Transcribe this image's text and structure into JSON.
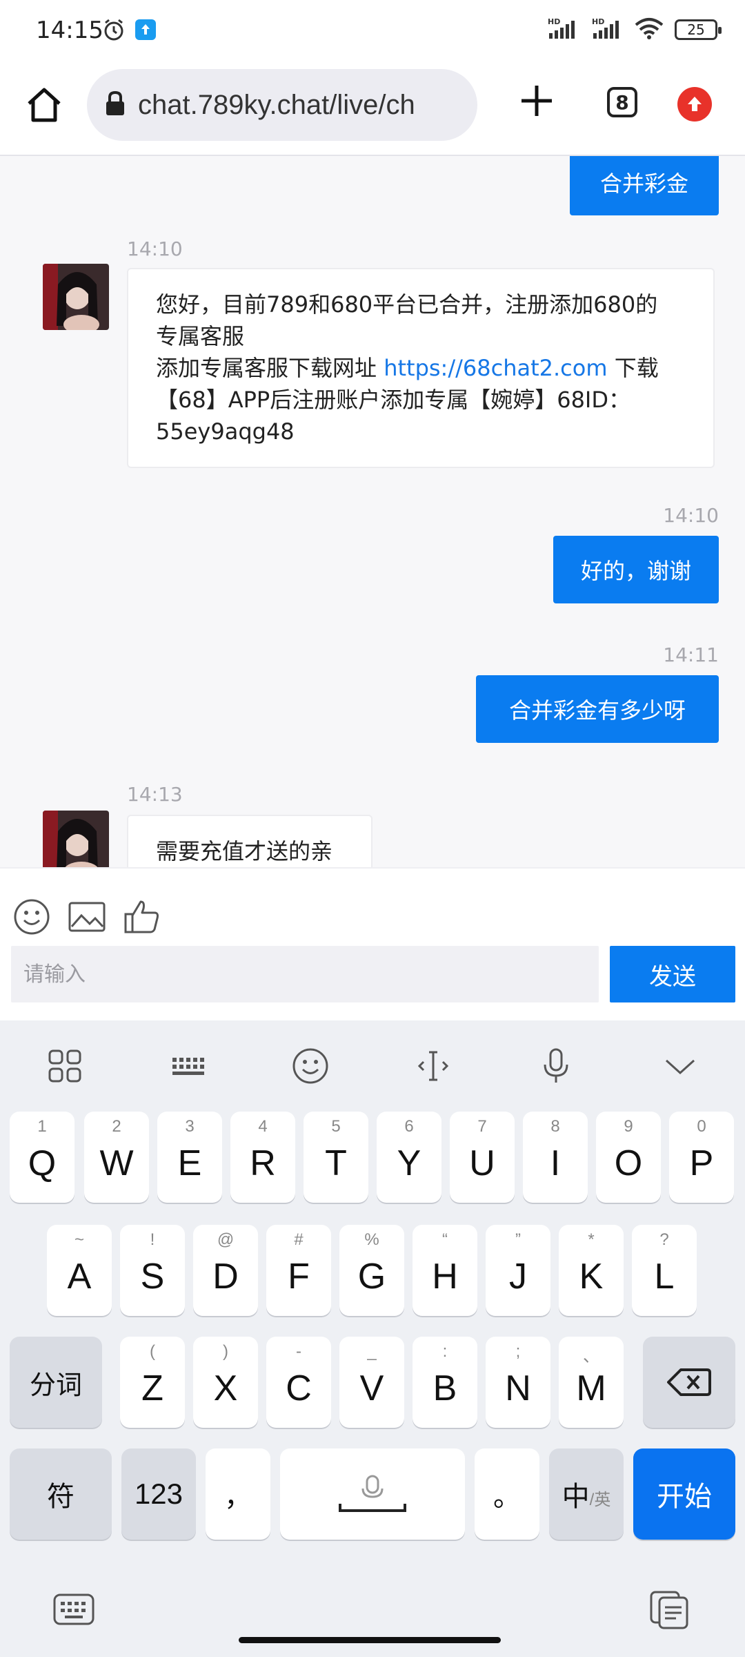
{
  "status_bar": {
    "time": "14:15",
    "battery": "25",
    "signal_label": "HD"
  },
  "browser": {
    "url": "chat.789ky.chat/live/ch",
    "tab_count": "8"
  },
  "chat": {
    "top_partial_message": "合并彩金",
    "messages": [
      {
        "time": "14:10",
        "direction": "in",
        "lines": [
          "您好，目前789和680平台已合并，注册添加680的",
          "专属客服"
        ],
        "line3_prefix": "添加专属客服下载网址 ",
        "link": "https://68chat2.com",
        "line3_suffix": " 下载",
        "line4": "【68】APP后注册账户添加专属【婉婷】68ID：",
        "line5": "55ey9aqg48"
      },
      {
        "time": "14:10",
        "direction": "out",
        "text": "好的，谢谢"
      },
      {
        "time": "14:11",
        "direction": "out",
        "text": "合并彩金有多少呀"
      },
      {
        "time": "14:13",
        "direction": "in",
        "text": "需要充值才送的亲"
      }
    ]
  },
  "composer": {
    "placeholder": "请输入",
    "send_label": "发送"
  },
  "keyboard": {
    "row1": [
      {
        "key": "Q",
        "sub": "1"
      },
      {
        "key": "W",
        "sub": "2"
      },
      {
        "key": "E",
        "sub": "3"
      },
      {
        "key": "R",
        "sub": "4"
      },
      {
        "key": "T",
        "sub": "5"
      },
      {
        "key": "Y",
        "sub": "6"
      },
      {
        "key": "U",
        "sub": "7"
      },
      {
        "key": "I",
        "sub": "8"
      },
      {
        "key": "O",
        "sub": "9"
      },
      {
        "key": "P",
        "sub": "0"
      }
    ],
    "row2": [
      {
        "key": "A",
        "sub": "~"
      },
      {
        "key": "S",
        "sub": "!"
      },
      {
        "key": "D",
        "sub": "@"
      },
      {
        "key": "F",
        "sub": "#"
      },
      {
        "key": "G",
        "sub": "%"
      },
      {
        "key": "H",
        "sub": "“"
      },
      {
        "key": "J",
        "sub": "”"
      },
      {
        "key": "K",
        "sub": "*"
      },
      {
        "key": "L",
        "sub": "?"
      }
    ],
    "row3": [
      {
        "key": "Z",
        "sub": "("
      },
      {
        "key": "X",
        "sub": ")"
      },
      {
        "key": "C",
        "sub": "-"
      },
      {
        "key": "V",
        "sub": "_"
      },
      {
        "key": "B",
        "sub": ":"
      },
      {
        "key": "N",
        "sub": ";"
      },
      {
        "key": "M",
        "sub": "、"
      }
    ],
    "segment_label": "分词",
    "symbol_label": "符",
    "numeric_label": "123",
    "comma_label": "，",
    "period_label": "。",
    "lang_main": "中",
    "lang_sub": "/英",
    "enter_label": "开始"
  }
}
